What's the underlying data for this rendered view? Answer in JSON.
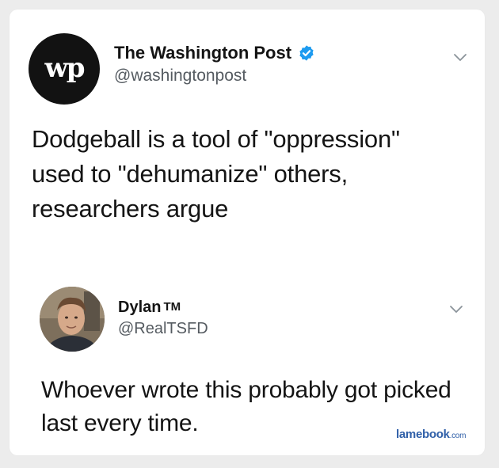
{
  "tweet1": {
    "avatar_text": "wp",
    "name": "The Washington Post",
    "handle": "@washingtonpost",
    "text": "Dodgeball is a tool of \"oppression\" used to \"dehumanize\" others, researchers argue"
  },
  "tweet2": {
    "name": "Dylan",
    "name_suffix": "TM",
    "handle": "@RealTSFD",
    "text": "Whoever wrote this probably got picked last every time."
  },
  "watermark": {
    "main": "lamebook",
    "domain": ".com"
  },
  "colors": {
    "verified": "#1d9bf0",
    "handle": "#555b61",
    "watermark": "#2f5fa8"
  },
  "icons": [
    "verified-badge-icon",
    "chevron-down-icon"
  ]
}
